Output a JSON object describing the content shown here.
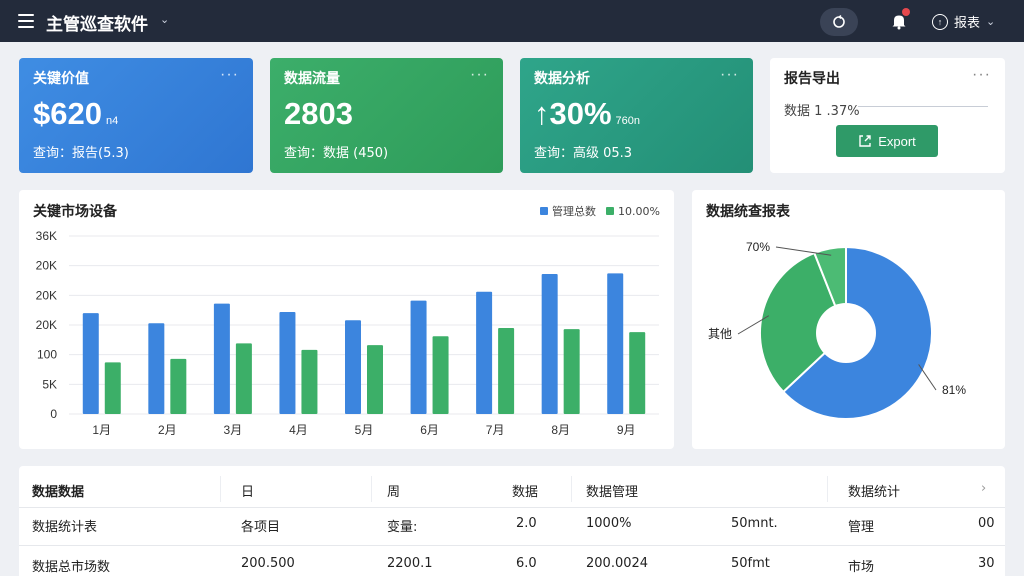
{
  "topbar": {
    "title": "主管巡查软件",
    "title_chevron": "⌄",
    "user_label": "报表",
    "user_chevron": "⌄"
  },
  "kpis": [
    {
      "title": "关键价值",
      "value": "$620",
      "unit": "n4",
      "sub": "查询：报告(5.3)",
      "more": "···"
    },
    {
      "title": "数据流量",
      "value": "2803",
      "unit": "",
      "sub": "查询：数据 (450)",
      "more": "···"
    },
    {
      "title": "数据分析",
      "value": "↑30%",
      "unit": "760n",
      "sub": "查询：高级 05.3",
      "more": "···"
    }
  ],
  "export_card": {
    "title": "报告导出",
    "line": "数据 1 .37%",
    "button_label": "Export",
    "more": "···"
  },
  "bar_chart_title": "关键市场设备",
  "pie_chart_title": "数据统查报表",
  "chart_data": [
    {
      "type": "bar",
      "title": "关键市场设备",
      "categories": [
        "1月",
        "2月",
        "3月",
        "4月",
        "5月",
        "6月",
        "7月",
        "8月",
        "9月"
      ],
      "y_tick_labels": [
        "36K",
        "20K",
        "20K",
        "20K",
        "100",
        "5K",
        "0"
      ],
      "y_tick_values": [
        30,
        25,
        20,
        15,
        10,
        5,
        0
      ],
      "series": [
        {
          "name": "管理总数",
          "color": "#3c85de",
          "values": [
            17,
            15.3,
            18.6,
            17.2,
            15.8,
            19.1,
            20.6,
            23.6,
            23.7
          ]
        },
        {
          "name": "10.00%",
          "color": "#3caf68",
          "values": [
            8.7,
            9.3,
            11.9,
            10.8,
            11.6,
            13.1,
            14.5,
            14.3,
            13.8
          ]
        }
      ],
      "ylim": [
        0,
        30
      ],
      "grid": true,
      "legend_position": "top-right"
    },
    {
      "type": "pie",
      "title": "数据统查报表",
      "labels": [
        "81%",
        "其他",
        "70%"
      ],
      "values": [
        63,
        31,
        6
      ],
      "colors": [
        "#3c85de",
        "#3caf68",
        "#4cbb74"
      ],
      "donut": true
    }
  ],
  "table": {
    "headers": [
      "数据数据",
      "日",
      "周",
      "数据",
      "数据管理",
      "数据统计",
      "›"
    ],
    "rows": [
      [
        "数据统计表",
        "各项目",
        "变量:",
        "2.0",
        "1000%",
        "50mnt.",
        "管理",
        "00"
      ],
      [
        "数据总市场数",
        "200.500",
        "2200.1",
        "6.0",
        "200.0024",
        "50fmt",
        "市场",
        "30"
      ]
    ]
  }
}
